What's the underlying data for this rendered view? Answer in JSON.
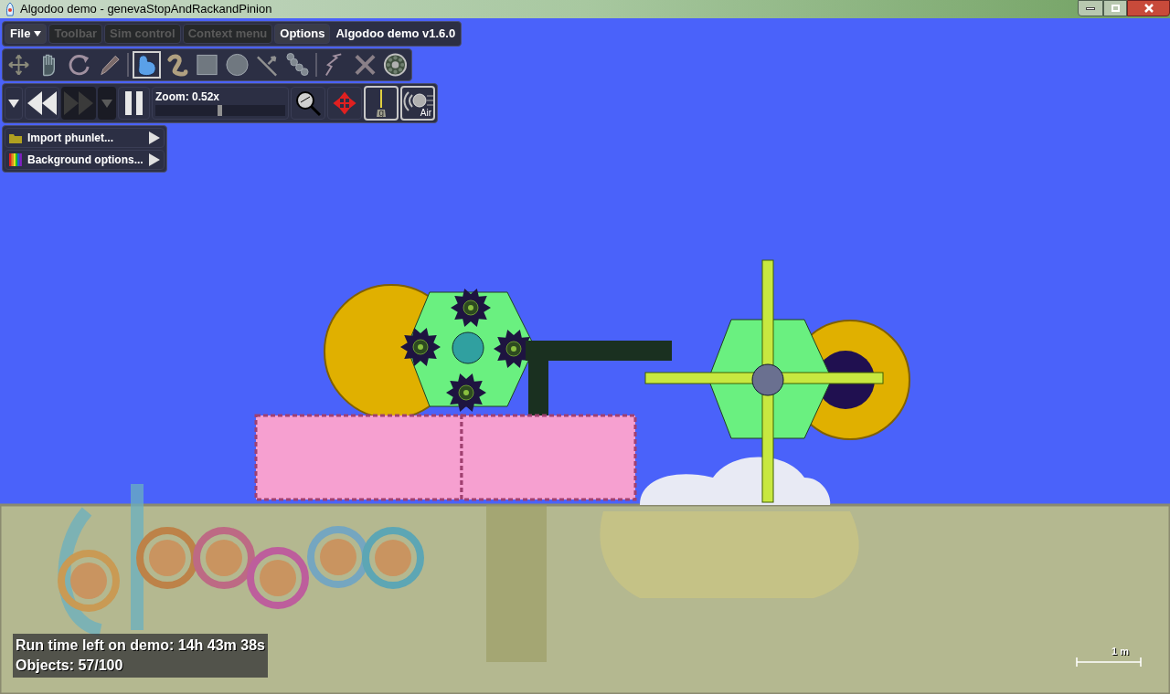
{
  "window": {
    "title": "Algodoo demo - genevaStopAndRackandPinion"
  },
  "menu": [
    {
      "label": "File",
      "kind": "dropdown",
      "disabled": false
    },
    {
      "label": "Toolbar",
      "kind": "button",
      "disabled": true
    },
    {
      "label": "Sim control",
      "kind": "button",
      "disabled": true
    },
    {
      "label": "Context menu",
      "kind": "button",
      "disabled": true
    },
    {
      "label": "Options",
      "kind": "button",
      "disabled": false
    }
  ],
  "version": "Algodoo demo v1.6.0",
  "tool_groups": [
    [
      {
        "kind": "move",
        "selected": false
      },
      {
        "kind": "hand",
        "selected": false
      },
      {
        "kind": "rotate",
        "selected": false
      },
      {
        "kind": "pen",
        "selected": false
      }
    ],
    [
      {
        "kind": "blob",
        "selected": true
      },
      {
        "kind": "rope",
        "selected": false
      },
      {
        "kind": "box",
        "selected": false
      },
      {
        "kind": "circle",
        "selected": false
      },
      {
        "kind": "arrow",
        "selected": false
      },
      {
        "kind": "chain",
        "selected": false
      }
    ],
    [
      {
        "kind": "spring",
        "selected": false
      },
      {
        "kind": "cross",
        "selected": false
      },
      {
        "kind": "gear",
        "selected": false
      }
    ]
  ],
  "sim_controls": [
    {
      "kind": "dropdown",
      "disabled": false
    },
    {
      "kind": "rewind",
      "disabled": false
    },
    {
      "kind": "forward",
      "disabled": true
    },
    {
      "kind": "dropdown",
      "disabled": true
    },
    {
      "kind": "pause",
      "disabled": false
    }
  ],
  "zoom": {
    "label": "Zoom: 0.52x",
    "level": 0.5
  },
  "toggles": [
    {
      "kind": "gravity",
      "label": "g",
      "on": true
    },
    {
      "kind": "air",
      "label": "Air",
      "on": true
    }
  ],
  "context_buttons": [
    {
      "kind": "folder",
      "label": "Import phunlet..."
    },
    {
      "kind": "palette",
      "label": "Background options..."
    }
  ],
  "status": [
    "Run time left on demo: 14h 43m 38s",
    "Objects: 57/100"
  ],
  "scale_label": "1 m"
}
